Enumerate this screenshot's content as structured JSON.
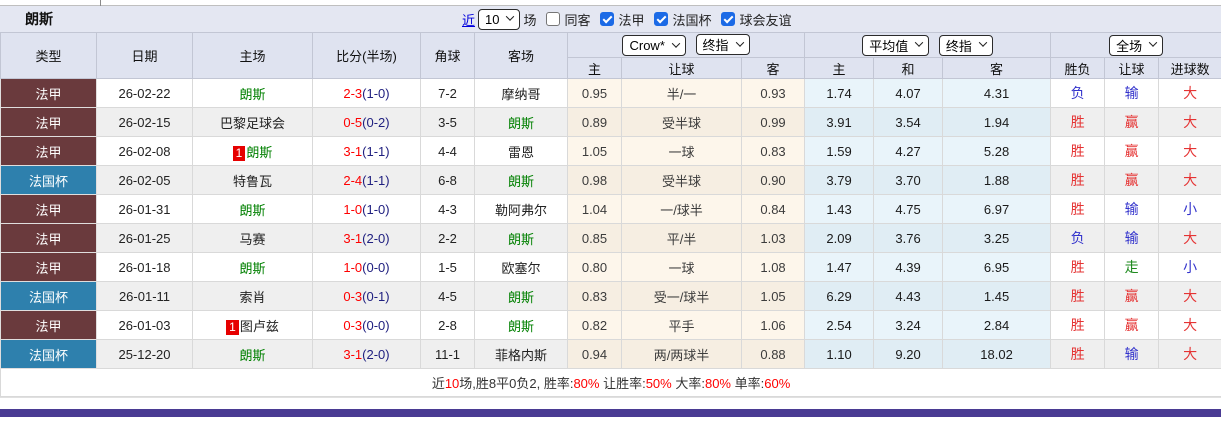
{
  "top": {
    "team_title": "朗斯"
  },
  "filter": {
    "recent_link": "近",
    "recent_count": "10",
    "unit_label": "场",
    "checkboxes": [
      {
        "label": "同客",
        "checked": false
      },
      {
        "label": "法甲",
        "checked": true
      },
      {
        "label": "法国杯",
        "checked": true
      },
      {
        "label": "球会友谊",
        "checked": true
      }
    ]
  },
  "table": {
    "static_headers": [
      "类型",
      "日期",
      "主场",
      "比分(半场)",
      "角球",
      "客场"
    ],
    "dropdowns": {
      "odds_source": "Crow*",
      "odds_source_final": "终指",
      "avg": "平均值",
      "avg_final": "终指",
      "scope": "全场"
    },
    "sub_headers": [
      "主",
      "让球",
      "客",
      "主",
      "和",
      "客",
      "胜负",
      "让球",
      "进球数"
    ],
    "focus_team": "朗斯",
    "rows": [
      {
        "type": "法甲",
        "date": "26-02-22",
        "home": {
          "badge": "",
          "name": "朗斯"
        },
        "score": {
          "ft": "2-3",
          "ht": "1-0"
        },
        "corners": "7-2",
        "away": {
          "badge": "",
          "name": "摩纳哥"
        },
        "crow": {
          "home": "0.95",
          "handicap": "半/一",
          "away": "0.93"
        },
        "avg": {
          "home": "1.74",
          "draw": "4.07",
          "away": "4.31"
        },
        "result": {
          "wl": "负",
          "wl_color": "blue",
          "handicap": "输",
          "handicap_color": "blue",
          "goals": "大",
          "goals_color": "red"
        }
      },
      {
        "type": "法甲",
        "date": "26-02-15",
        "home": {
          "badge": "",
          "name": "巴黎足球会"
        },
        "score": {
          "ft": "0-5",
          "ht": "0-2"
        },
        "corners": "3-5",
        "away": {
          "badge": "",
          "name": "朗斯"
        },
        "crow": {
          "home": "0.89",
          "handicap": "受半球",
          "away": "0.99"
        },
        "avg": {
          "home": "3.91",
          "draw": "3.54",
          "away": "1.94"
        },
        "result": {
          "wl": "胜",
          "wl_color": "red",
          "handicap": "赢",
          "handicap_color": "red",
          "goals": "大",
          "goals_color": "red"
        }
      },
      {
        "type": "法甲",
        "date": "26-02-08",
        "home": {
          "badge": "1",
          "name": "朗斯"
        },
        "score": {
          "ft": "3-1",
          "ht": "1-1"
        },
        "corners": "4-4",
        "away": {
          "badge": "",
          "name": "雷恩"
        },
        "crow": {
          "home": "1.05",
          "handicap": "一球",
          "away": "0.83"
        },
        "avg": {
          "home": "1.59",
          "draw": "4.27",
          "away": "5.28"
        },
        "result": {
          "wl": "胜",
          "wl_color": "red",
          "handicap": "赢",
          "handicap_color": "red",
          "goals": "大",
          "goals_color": "red"
        }
      },
      {
        "type": "法国杯",
        "date": "26-02-05",
        "home": {
          "badge": "",
          "name": "特鲁瓦"
        },
        "score": {
          "ft": "2-4",
          "ht": "1-1"
        },
        "corners": "6-8",
        "away": {
          "badge": "",
          "name": "朗斯"
        },
        "crow": {
          "home": "0.98",
          "handicap": "受半球",
          "away": "0.90"
        },
        "avg": {
          "home": "3.79",
          "draw": "3.70",
          "away": "1.88"
        },
        "result": {
          "wl": "胜",
          "wl_color": "red",
          "handicap": "赢",
          "handicap_color": "red",
          "goals": "大",
          "goals_color": "red"
        }
      },
      {
        "type": "法甲",
        "date": "26-01-31",
        "home": {
          "badge": "",
          "name": "朗斯"
        },
        "score": {
          "ft": "1-0",
          "ht": "1-0"
        },
        "corners": "4-3",
        "away": {
          "badge": "",
          "name": "勒阿弗尔"
        },
        "crow": {
          "home": "1.04",
          "handicap": "一/球半",
          "away": "0.84"
        },
        "avg": {
          "home": "1.43",
          "draw": "4.75",
          "away": "6.97"
        },
        "result": {
          "wl": "胜",
          "wl_color": "red",
          "handicap": "输",
          "handicap_color": "blue",
          "goals": "小",
          "goals_color": "blue"
        }
      },
      {
        "type": "法甲",
        "date": "26-01-25",
        "home": {
          "badge": "",
          "name": "马赛"
        },
        "score": {
          "ft": "3-1",
          "ht": "2-0"
        },
        "corners": "2-2",
        "away": {
          "badge": "",
          "name": "朗斯"
        },
        "crow": {
          "home": "0.85",
          "handicap": "平/半",
          "away": "1.03"
        },
        "avg": {
          "home": "2.09",
          "draw": "3.76",
          "away": "3.25"
        },
        "result": {
          "wl": "负",
          "wl_color": "blue",
          "handicap": "输",
          "handicap_color": "blue",
          "goals": "大",
          "goals_color": "red"
        }
      },
      {
        "type": "法甲",
        "date": "26-01-18",
        "home": {
          "badge": "",
          "name": "朗斯"
        },
        "score": {
          "ft": "1-0",
          "ht": "0-0"
        },
        "corners": "1-5",
        "away": {
          "badge": "",
          "name": "欧塞尔"
        },
        "crow": {
          "home": "0.80",
          "handicap": "一球",
          "away": "1.08"
        },
        "avg": {
          "home": "1.47",
          "draw": "4.39",
          "away": "6.95"
        },
        "result": {
          "wl": "胜",
          "wl_color": "red",
          "handicap": "走",
          "handicap_color": "green",
          "goals": "小",
          "goals_color": "blue"
        }
      },
      {
        "type": "法国杯",
        "date": "26-01-11",
        "home": {
          "badge": "",
          "name": "索肖"
        },
        "score": {
          "ft": "0-3",
          "ht": "0-1"
        },
        "corners": "4-5",
        "away": {
          "badge": "",
          "name": "朗斯"
        },
        "crow": {
          "home": "0.83",
          "handicap": "受一/球半",
          "away": "1.05"
        },
        "avg": {
          "home": "6.29",
          "draw": "4.43",
          "away": "1.45"
        },
        "result": {
          "wl": "胜",
          "wl_color": "red",
          "handicap": "赢",
          "handicap_color": "red",
          "goals": "大",
          "goals_color": "red"
        }
      },
      {
        "type": "法甲",
        "date": "26-01-03",
        "home": {
          "badge": "1",
          "name": "图卢兹"
        },
        "score": {
          "ft": "0-3",
          "ht": "0-0"
        },
        "corners": "2-8",
        "away": {
          "badge": "",
          "name": "朗斯"
        },
        "crow": {
          "home": "0.82",
          "handicap": "平手",
          "away": "1.06"
        },
        "avg": {
          "home": "2.54",
          "draw": "3.24",
          "away": "2.84"
        },
        "result": {
          "wl": "胜",
          "wl_color": "red",
          "handicap": "赢",
          "handicap_color": "red",
          "goals": "大",
          "goals_color": "red"
        }
      },
      {
        "type": "法国杯",
        "date": "25-12-20",
        "home": {
          "badge": "",
          "name": "朗斯"
        },
        "score": {
          "ft": "3-1",
          "ht": "2-0"
        },
        "corners": "11-1",
        "away": {
          "badge": "",
          "name": "菲格内斯"
        },
        "crow": {
          "home": "0.94",
          "handicap": "两/两球半",
          "away": "0.88"
        },
        "avg": {
          "home": "1.10",
          "draw": "9.20",
          "away": "18.02"
        },
        "result": {
          "wl": "胜",
          "wl_color": "red",
          "handicap": "输",
          "handicap_color": "blue",
          "goals": "大",
          "goals_color": "red"
        }
      }
    ]
  },
  "summary": {
    "parts": [
      {
        "text": "近"
      },
      {
        "text": "10"
      },
      {
        "text": "场,胜8平0负2, 胜率:"
      },
      {
        "text": "80%"
      },
      {
        "text": " 让胜率:"
      },
      {
        "text": "50%"
      },
      {
        "text": " 大率:"
      },
      {
        "text": "80%"
      },
      {
        "text": " 单率:"
      },
      {
        "text": "60%"
      }
    ]
  },
  "colors": {
    "league_badge": "#6a3a3d",
    "cup_badge": "#2e80ad",
    "focus_team_green": "#008000",
    "score_red": "#ff0000",
    "halftime_navy": "#202080",
    "result_red": "#e53333",
    "result_blue": "#3333cc",
    "result_green": "#1e8a1e",
    "header_bg": "#dfe3f0",
    "crow_col_bg": "#fdf6eb",
    "avg_col_bg": "#e9f4fa",
    "accent_bar": "#4a3b93"
  }
}
